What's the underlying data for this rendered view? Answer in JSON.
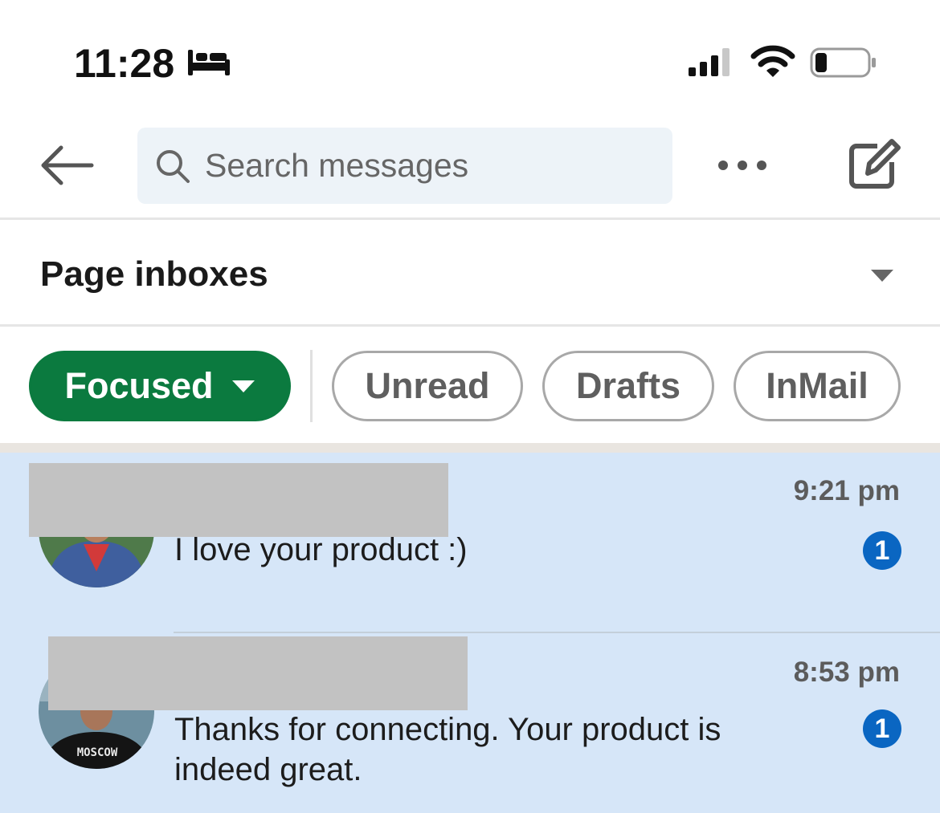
{
  "status_bar": {
    "time": "11:28",
    "icons": [
      "bed-icon",
      "signal-icon",
      "wifi-icon",
      "battery-icon"
    ]
  },
  "header": {
    "back_icon": "arrow-left-icon",
    "search": {
      "placeholder": "Search messages",
      "value": ""
    },
    "more_icon": "ellipsis-icon",
    "compose_icon": "compose-icon"
  },
  "inbox_selector": {
    "label": "Page inboxes"
  },
  "filters": {
    "focused": "Focused",
    "unread": "Unread",
    "drafts": "Drafts",
    "inmail": "InMail",
    "active": "Focused"
  },
  "conversations": [
    {
      "sender": "",
      "preview": "I love your product :)",
      "time": "9:21 pm",
      "unread_count": "1"
    },
    {
      "sender": "",
      "preview": "Thanks for connecting. Your product is indeed great.",
      "time": "8:53 pm",
      "unread_count": "1",
      "avatar_shirt_text": "MOSCOW"
    }
  ],
  "colors": {
    "accent_green": "#0b7a3f",
    "badge_blue": "#0a66c2",
    "unread_row_bg": "#d6e6f8",
    "search_bg": "#edf3f8"
  }
}
